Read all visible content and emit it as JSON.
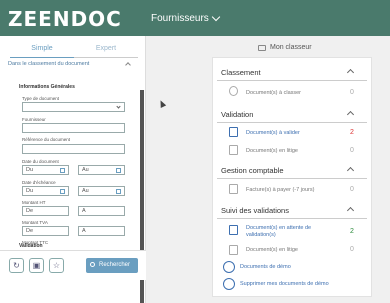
{
  "app": {
    "logo": "ZEENDOC",
    "module": "Fournisseurs"
  },
  "sidebar": {
    "tabs": [
      "Simple",
      "Expert"
    ],
    "section": "Dans le classement du document",
    "group": "Informations Générales",
    "fields": {
      "type_document": "Type de document",
      "fournisseur": "Fournisseur",
      "reference": "Référence du document",
      "date_document": "Date du document",
      "date_echeance": "Date d'échéance",
      "montant_ht": "Montant HT",
      "montant_tva": "Montant TVA",
      "montant_ttc": "Montant TTC"
    },
    "range": {
      "du": "Du",
      "au": "Au",
      "de": "De",
      "a": "A"
    },
    "validation_group": "Validation",
    "search_button": "Rechercher",
    "icons": [
      "refresh-icon",
      "save-icon",
      "star-icon"
    ]
  },
  "main": {
    "title": "Mon classeur",
    "sections": [
      {
        "title": "Classement",
        "items": [
          {
            "label": "Document(s) à classer",
            "count": "0",
            "style": "muted"
          }
        ]
      },
      {
        "title": "Validation",
        "items": [
          {
            "label": "Document(s) à valider",
            "count": "2",
            "style": "red"
          },
          {
            "label": "Document(s) en litige",
            "count": "0",
            "style": "muted"
          }
        ]
      },
      {
        "title": "Gestion comptable",
        "items": [
          {
            "label": "Facture(s) à payer (-7 jours)",
            "count": "0",
            "style": "muted"
          }
        ]
      },
      {
        "title": "Suivi des validations",
        "items": [
          {
            "label": "Document(s) en attente de validation(s)",
            "count": "2",
            "style": "green"
          },
          {
            "label": "Document(s) en litige",
            "count": "0",
            "style": "muted"
          }
        ]
      }
    ],
    "links": {
      "demo": "Documents de démo",
      "delete_demo": "Supprimer mes documents de démo"
    }
  },
  "colors": {
    "header": "#4a7a6c",
    "accent": "#6a9ec0",
    "link": "#3d6fb0",
    "alert": "#dd3333",
    "ok": "#2a8a3a"
  }
}
